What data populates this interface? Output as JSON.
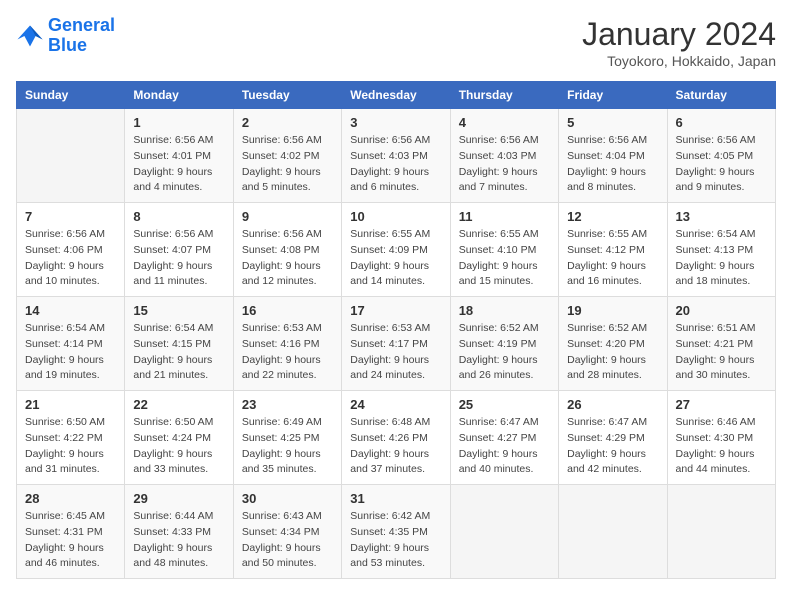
{
  "logo": {
    "text_general": "General",
    "text_blue": "Blue"
  },
  "header": {
    "month": "January 2024",
    "location": "Toyokoro, Hokkaido, Japan"
  },
  "days_of_week": [
    "Sunday",
    "Monday",
    "Tuesday",
    "Wednesday",
    "Thursday",
    "Friday",
    "Saturday"
  ],
  "weeks": [
    [
      {
        "day": "",
        "info": ""
      },
      {
        "day": "1",
        "info": "Sunrise: 6:56 AM\nSunset: 4:01 PM\nDaylight: 9 hours\nand 4 minutes."
      },
      {
        "day": "2",
        "info": "Sunrise: 6:56 AM\nSunset: 4:02 PM\nDaylight: 9 hours\nand 5 minutes."
      },
      {
        "day": "3",
        "info": "Sunrise: 6:56 AM\nSunset: 4:03 PM\nDaylight: 9 hours\nand 6 minutes."
      },
      {
        "day": "4",
        "info": "Sunrise: 6:56 AM\nSunset: 4:03 PM\nDaylight: 9 hours\nand 7 minutes."
      },
      {
        "day": "5",
        "info": "Sunrise: 6:56 AM\nSunset: 4:04 PM\nDaylight: 9 hours\nand 8 minutes."
      },
      {
        "day": "6",
        "info": "Sunrise: 6:56 AM\nSunset: 4:05 PM\nDaylight: 9 hours\nand 9 minutes."
      }
    ],
    [
      {
        "day": "7",
        "info": "Sunrise: 6:56 AM\nSunset: 4:06 PM\nDaylight: 9 hours\nand 10 minutes."
      },
      {
        "day": "8",
        "info": "Sunrise: 6:56 AM\nSunset: 4:07 PM\nDaylight: 9 hours\nand 11 minutes."
      },
      {
        "day": "9",
        "info": "Sunrise: 6:56 AM\nSunset: 4:08 PM\nDaylight: 9 hours\nand 12 minutes."
      },
      {
        "day": "10",
        "info": "Sunrise: 6:55 AM\nSunset: 4:09 PM\nDaylight: 9 hours\nand 14 minutes."
      },
      {
        "day": "11",
        "info": "Sunrise: 6:55 AM\nSunset: 4:10 PM\nDaylight: 9 hours\nand 15 minutes."
      },
      {
        "day": "12",
        "info": "Sunrise: 6:55 AM\nSunset: 4:12 PM\nDaylight: 9 hours\nand 16 minutes."
      },
      {
        "day": "13",
        "info": "Sunrise: 6:54 AM\nSunset: 4:13 PM\nDaylight: 9 hours\nand 18 minutes."
      }
    ],
    [
      {
        "day": "14",
        "info": "Sunrise: 6:54 AM\nSunset: 4:14 PM\nDaylight: 9 hours\nand 19 minutes."
      },
      {
        "day": "15",
        "info": "Sunrise: 6:54 AM\nSunset: 4:15 PM\nDaylight: 9 hours\nand 21 minutes."
      },
      {
        "day": "16",
        "info": "Sunrise: 6:53 AM\nSunset: 4:16 PM\nDaylight: 9 hours\nand 22 minutes."
      },
      {
        "day": "17",
        "info": "Sunrise: 6:53 AM\nSunset: 4:17 PM\nDaylight: 9 hours\nand 24 minutes."
      },
      {
        "day": "18",
        "info": "Sunrise: 6:52 AM\nSunset: 4:19 PM\nDaylight: 9 hours\nand 26 minutes."
      },
      {
        "day": "19",
        "info": "Sunrise: 6:52 AM\nSunset: 4:20 PM\nDaylight: 9 hours\nand 28 minutes."
      },
      {
        "day": "20",
        "info": "Sunrise: 6:51 AM\nSunset: 4:21 PM\nDaylight: 9 hours\nand 30 minutes."
      }
    ],
    [
      {
        "day": "21",
        "info": "Sunrise: 6:50 AM\nSunset: 4:22 PM\nDaylight: 9 hours\nand 31 minutes."
      },
      {
        "day": "22",
        "info": "Sunrise: 6:50 AM\nSunset: 4:24 PM\nDaylight: 9 hours\nand 33 minutes."
      },
      {
        "day": "23",
        "info": "Sunrise: 6:49 AM\nSunset: 4:25 PM\nDaylight: 9 hours\nand 35 minutes."
      },
      {
        "day": "24",
        "info": "Sunrise: 6:48 AM\nSunset: 4:26 PM\nDaylight: 9 hours\nand 37 minutes."
      },
      {
        "day": "25",
        "info": "Sunrise: 6:47 AM\nSunset: 4:27 PM\nDaylight: 9 hours\nand 40 minutes."
      },
      {
        "day": "26",
        "info": "Sunrise: 6:47 AM\nSunset: 4:29 PM\nDaylight: 9 hours\nand 42 minutes."
      },
      {
        "day": "27",
        "info": "Sunrise: 6:46 AM\nSunset: 4:30 PM\nDaylight: 9 hours\nand 44 minutes."
      }
    ],
    [
      {
        "day": "28",
        "info": "Sunrise: 6:45 AM\nSunset: 4:31 PM\nDaylight: 9 hours\nand 46 minutes."
      },
      {
        "day": "29",
        "info": "Sunrise: 6:44 AM\nSunset: 4:33 PM\nDaylight: 9 hours\nand 48 minutes."
      },
      {
        "day": "30",
        "info": "Sunrise: 6:43 AM\nSunset: 4:34 PM\nDaylight: 9 hours\nand 50 minutes."
      },
      {
        "day": "31",
        "info": "Sunrise: 6:42 AM\nSunset: 4:35 PM\nDaylight: 9 hours\nand 53 minutes."
      },
      {
        "day": "",
        "info": ""
      },
      {
        "day": "",
        "info": ""
      },
      {
        "day": "",
        "info": ""
      }
    ]
  ]
}
